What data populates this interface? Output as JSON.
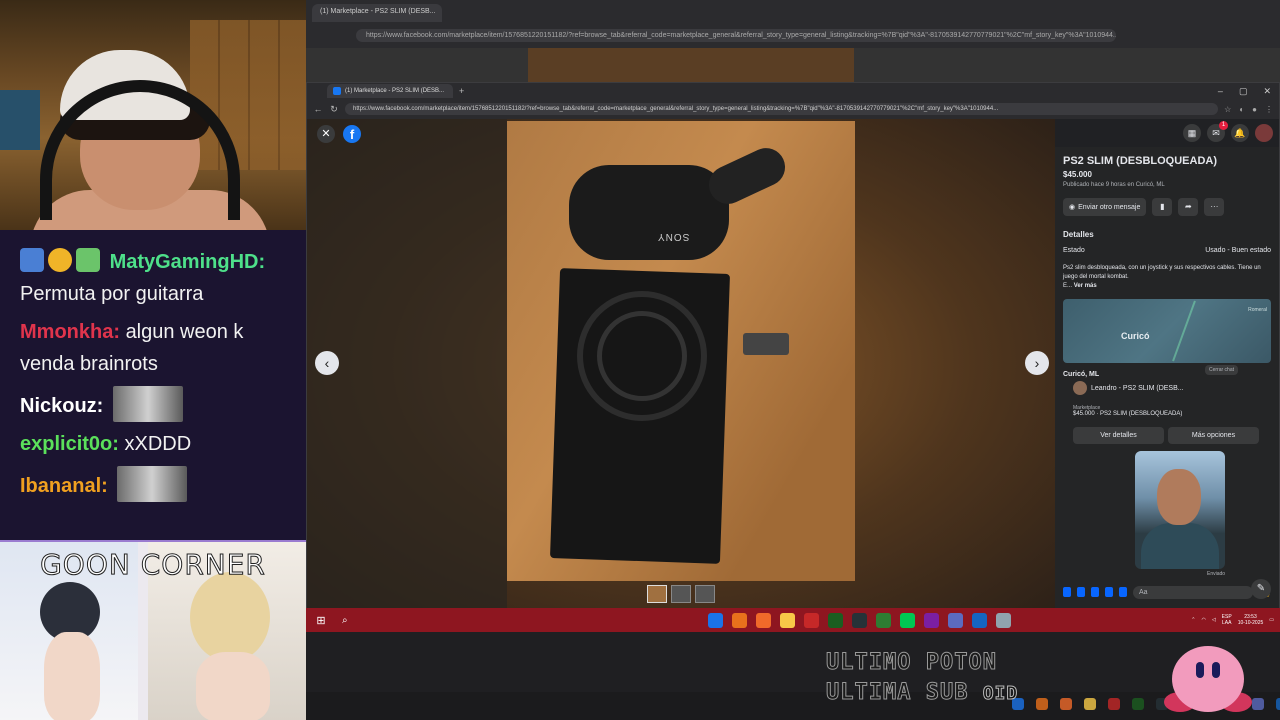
{
  "stream": {
    "chat": [
      {
        "user": "MatyGamingHD:",
        "user_color": "#4ee08a",
        "text": "Permuta por guitarra",
        "badges": [
          "#4a7fd4",
          "#f0b428",
          "#6bc46a"
        ]
      },
      {
        "user": "Mmonkha:",
        "user_color": "#e0344c",
        "text": "algun weon k venda brainrots"
      },
      {
        "user": "Nickouz:",
        "user_color": "#ffffff",
        "text": ""
      },
      {
        "user": "explicit0o:",
        "user_color": "#5be05b",
        "text": "xXDDD"
      },
      {
        "user": "Ibananal:",
        "user_color": "#f0a020",
        "text": ""
      }
    ],
    "goon_title": "GOON CORNER",
    "overlay_line1": "ULTIMO POTON",
    "overlay_line2": "ULTIMA SUB",
    "overlay_pid": "OID"
  },
  "outer_browser": {
    "tab_title": "(1) Marketplace - PS2 SLIM (DESB...",
    "url": "https://www.facebook.com/marketplace/item/1576851220151182/?ref=browse_tab&referral_code=marketplace_general&referral_story_type=general_listing&tracking=%7B\"qid\"%3A\"-8170539142770779021\"%2C\"mf_story_key\"%3A\"1010944..."
  },
  "browser": {
    "tab_title": "(1) Marketplace - PS2 SLIM (DESB...",
    "url": "https://www.facebook.com/marketplace/item/1576851220151182/?ref=browse_tab&referral_code=marketplace_general&referral_story_type=general_listing&tracking=%7B\"qid\"%3A\"-8170539142770779021\"%2C\"mf_story_key\"%3A\"1010944..."
  },
  "photo": {
    "brand": "SONY"
  },
  "listing": {
    "title": "PS2 SLIM (DESBLOQUEADA)",
    "price": "$45.000",
    "meta": "Publicado hace 9 horas en Curicó, ML",
    "send_message": "Enviar otro mensaje",
    "details_heading": "Detalles",
    "condition_label": "Estado",
    "condition_value": "Usado - Buen estado",
    "description": "Ps2 slim desbloqueada, con un joystick y sus respectivos cables. Tiene un juego del mortal kombat.",
    "description_tail": "E...",
    "see_more": "Ver más",
    "map_city": "Curicó",
    "map_mini": "Romeral",
    "location": "Curicó, ML"
  },
  "messenger": {
    "close_chat_tip": "Cerrar chat",
    "chat_name": "Leandro - PS2 SLIM (DESB...",
    "card_source": "Marketplace",
    "card_text": "$45.000 · PS2 SLIM (DESBLOQUEADA)",
    "btn_details": "Ver detalles",
    "btn_more": "Más opciones",
    "sent_label": "Enviado",
    "composer_placeholder": "Aa"
  },
  "taskbar": {
    "lang_line1": "ESP",
    "lang_line2": "LAA",
    "time": "23:53",
    "date": "10-10-2025",
    "app_colors": [
      "#1a73e8",
      "#e8711c",
      "#f06a2a",
      "#f7c948",
      "#c62828",
      "#1b5e20",
      "#263238",
      "#2e7d32",
      "#00c853",
      "#7b1fa2",
      "#5c6bc0",
      "#1565c0",
      "#90a4ae"
    ]
  },
  "colors": {
    "accent": "#1877f2",
    "taskbar": "#8e1620",
    "panel": "#242526"
  }
}
